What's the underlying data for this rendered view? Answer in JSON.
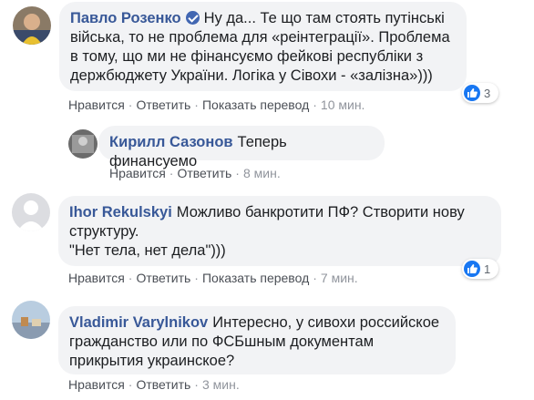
{
  "comments": [
    {
      "author": "Павло Розенко",
      "verified": true,
      "text": "Ну да... Те що там стоять путінські війська, то не проблема для «реінтеграції». Проблема в тому, що ми не фінансуємо фейкові республіки з держбюджету України. Логіка у Сівохи - «залізна»)))",
      "actions": {
        "like": "Нравится",
        "reply": "Ответить",
        "translate": "Показать перевод",
        "time": "10 мин."
      },
      "reactions": "3"
    },
    {
      "author": "Кирилл Сазонов",
      "text": "Теперь финансуемо",
      "actions": {
        "like": "Нравится",
        "reply": "Ответить",
        "time": "8 мин."
      }
    },
    {
      "author": "Ihor Rekulskyi",
      "text_lines": [
        "Можливо банкротити ПФ? Створити нову",
        "структуру.",
        "\"Нет тела, нет дела\")))"
      ],
      "actions": {
        "like": "Нравится",
        "reply": "Ответить",
        "translate": "Показать перевод",
        "time": "7 мин."
      },
      "reactions": "1"
    },
    {
      "author": "Vladimir Varylnikov",
      "text": "Интересно, у сивохи российское гражданство или по ФСБшным документам прикрытия украинское?",
      "actions": {
        "like": "Нравится",
        "reply": "Ответить",
        "time": "3 мин."
      }
    }
  ],
  "colors": {
    "bubble": "#f2f3f5",
    "author": "#385898",
    "like": "#1877f2"
  },
  "icons": {
    "verified": "verified-badge-icon",
    "like": "like-icon"
  }
}
